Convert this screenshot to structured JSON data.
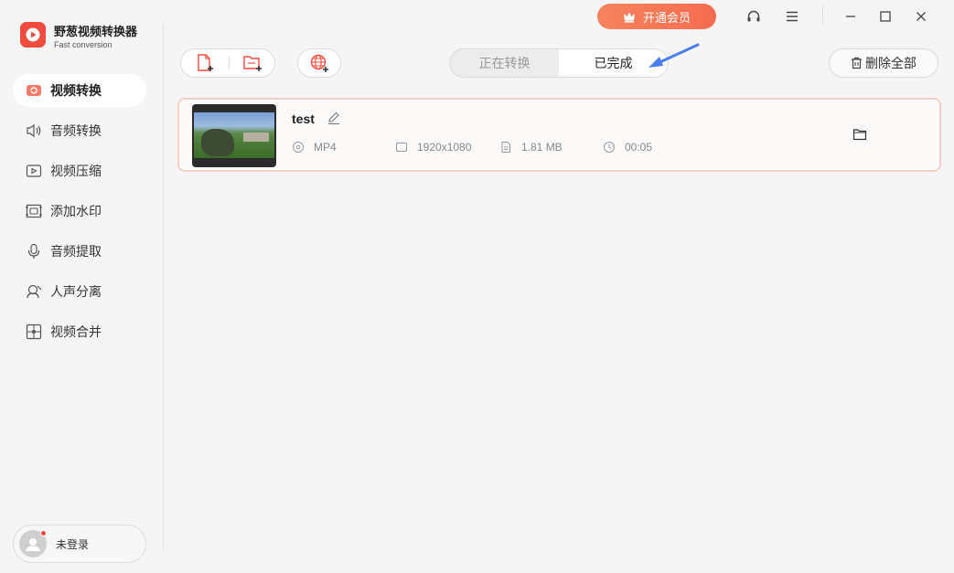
{
  "app": {
    "name": "野葱视频转换器",
    "subtitle": "Fast conversion",
    "brand_color": "#f04b3f"
  },
  "titlebar": {
    "vip_label": "开通会员",
    "icons": [
      "headset-icon",
      "menu-icon",
      "minimize-icon",
      "maximize-icon",
      "close-icon"
    ]
  },
  "sidebar": {
    "items": [
      {
        "label": "视频转换",
        "icon": "video-convert-icon",
        "active": true
      },
      {
        "label": "音频转换",
        "icon": "audio-convert-icon",
        "active": false
      },
      {
        "label": "视频压缩",
        "icon": "video-compress-icon",
        "active": false
      },
      {
        "label": "添加水印",
        "icon": "watermark-icon",
        "active": false
      },
      {
        "label": "音频提取",
        "icon": "audio-extract-icon",
        "active": false
      },
      {
        "label": "人声分离",
        "icon": "vocal-separate-icon",
        "active": false
      },
      {
        "label": "视频合并",
        "icon": "video-merge-icon",
        "active": false
      }
    ]
  },
  "user": {
    "label": "未登录"
  },
  "toolbar": {
    "tabs": [
      {
        "label": "正在转换",
        "selected": false
      },
      {
        "label": "已完成",
        "selected": true
      }
    ],
    "delete_all_label": "删除全部"
  },
  "files": [
    {
      "name": "test",
      "format": "MP4",
      "resolution": "1920x1080",
      "size": "1.81 MB",
      "duration": "00:05"
    }
  ]
}
